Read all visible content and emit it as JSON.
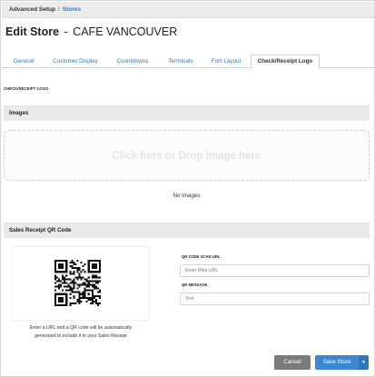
{
  "breadcrumb": {
    "parent": "Advanced Setup",
    "separator": "/",
    "current": "Stores"
  },
  "title": {
    "prefix": "Edit Store",
    "dash": "-",
    "store_name": "CAFE VANCOUVER"
  },
  "tabs": [
    {
      "label": "General"
    },
    {
      "label": "Customer Display"
    },
    {
      "label": "Countdowns"
    },
    {
      "label": "Terminals"
    },
    {
      "label": "FoH Layout"
    },
    {
      "label": "Check/Receipt Logo",
      "active": true
    }
  ],
  "logo_section": {
    "heading": "CHECK/RECEIPT LOGO"
  },
  "images_section": {
    "title": "Images",
    "dropzone_text": "Click here or Drop image here",
    "empty_text": "No Images"
  },
  "qr_section": {
    "title": "Sales Receipt QR Code",
    "help_line1": "Enter a URL and a QR code will be automatically",
    "help_line2": "generated to include it in your Sales Receipt",
    "url_label": "QR CODE SCAN URL",
    "url_placeholder": "Enter Web URL",
    "url_value": "",
    "message_label": "QR MESSAGE",
    "message_placeholder": "Text",
    "message_value": ""
  },
  "footer": {
    "cancel_label": "Cancel",
    "save_label": "Save Store",
    "save_menu_icon": "caret-down-icon"
  },
  "colors": {
    "accent": "#3b87d2",
    "link": "#2e7bbf",
    "cancel": "#7b7b7b",
    "bar": "#e9e9e9"
  }
}
